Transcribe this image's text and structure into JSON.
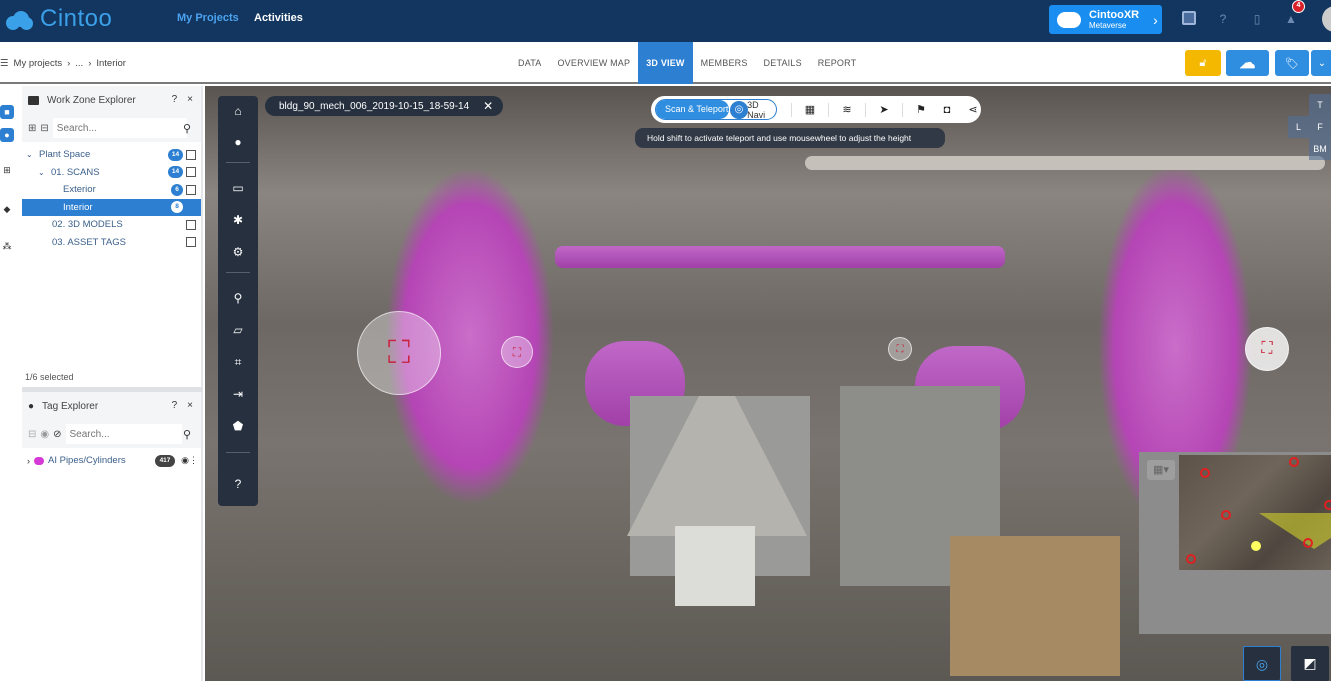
{
  "app": {
    "name": "Cintoo"
  },
  "topnav": {
    "links": [
      "My Projects",
      "Activities"
    ],
    "xr_button": {
      "title": "CintooXR",
      "subtitle": "Metaverse"
    },
    "notification_count": "4",
    "icons": [
      "notes-icon",
      "help-icon",
      "document-icon",
      "bell-icon"
    ]
  },
  "breadcrumb": {
    "items": [
      "My projects",
      "...",
      "Interior"
    ]
  },
  "tabs": [
    {
      "label": "DATA",
      "active": false
    },
    {
      "label": "OVERVIEW MAP",
      "active": false
    },
    {
      "label": "3D VIEW",
      "active": true
    },
    {
      "label": "MEMBERS",
      "active": false
    },
    {
      "label": "DETAILS",
      "active": false
    },
    {
      "label": "REPORT",
      "active": false
    }
  ],
  "colors": {
    "brand": "#123660",
    "accent": "#2c7fd1",
    "lock": "#f5b800",
    "tag": "#d63ad6"
  },
  "work_zone": {
    "title": "Work Zone Explorer",
    "help": "?",
    "close": "×",
    "search_placeholder": "Search...",
    "tree": [
      {
        "label": "Plant Space",
        "count": "14",
        "level": 0,
        "expanded": true,
        "selected": false,
        "checkbox": true
      },
      {
        "label": "01. SCANS",
        "count": "14",
        "level": 1,
        "expanded": true,
        "selected": false,
        "checkbox": true
      },
      {
        "label": "Exterior",
        "count": "6",
        "level": 2,
        "selected": false,
        "checkbox": true
      },
      {
        "label": "Interior",
        "count": "8",
        "level": 2,
        "selected": true,
        "checkbox": false
      },
      {
        "label": "02. 3D MODELS",
        "count": "",
        "level": 1,
        "selected": false,
        "checkbox": true
      },
      {
        "label": "03. ASSET TAGS",
        "count": "",
        "level": 1,
        "selected": false,
        "checkbox": true
      }
    ],
    "selection_status": "1/6 selected"
  },
  "tag_explorer": {
    "title": "Tag Explorer",
    "help": "?",
    "close": "×",
    "search_placeholder": "Search...",
    "items": [
      {
        "label": "AI Pipes/Cylinders",
        "count": "417"
      }
    ]
  },
  "viewer": {
    "scan_name": "bldg_90_mech_006_2019-10-15_18-59-14",
    "mode_on": "Scan & Teleport",
    "mode_off": "3D Navi",
    "hint": "Hold shift to activate teleport and use mousewheel to adjust the height",
    "view_cube": [
      "T",
      "L",
      "F",
      "BM"
    ]
  }
}
